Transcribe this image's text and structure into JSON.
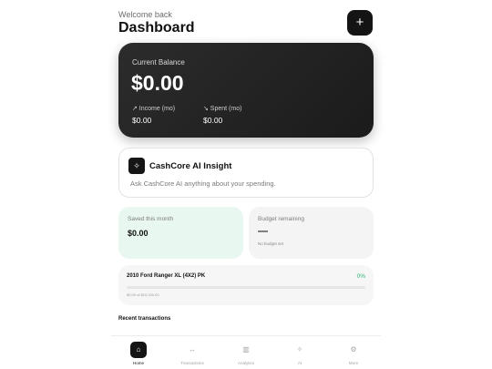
{
  "header": {
    "welcome": "Welcome back",
    "title": "Dashboard",
    "add_icon": "plus-icon",
    "add_label": "+"
  },
  "balance": {
    "label": "Current Balance",
    "amount": "$0.00",
    "income_label": "↗ Income (mo)",
    "income_value": "$0.00",
    "spent_label": "↘ Spent (mo)",
    "spent_value": "$0.00"
  },
  "ai_insight": {
    "icon": "sparkle-icon",
    "icon_glyph": "✧",
    "title": "CashCore AI Insight",
    "subtitle": "Ask CashCore AI anything about your spending."
  },
  "saved": {
    "label": "Saved this month",
    "value": "$0.00"
  },
  "budget": {
    "label": "Budget remaining",
    "value": "—",
    "note": "No budget set"
  },
  "goal": {
    "name": "2010 Ford Ranger XL (4X2) PK",
    "percent_label": "0%",
    "progress": 0,
    "subtext": "$0.00 of $10,000.00"
  },
  "recent": {
    "title": "Recent transactions"
  },
  "nav": {
    "active_color": "#141414",
    "items": [
      {
        "label": "Home",
        "icon": "home-icon",
        "glyph": "⌂"
      },
      {
        "label": "Transactions",
        "icon": "transactions-icon",
        "glyph": "↔"
      },
      {
        "label": "Analytics",
        "icon": "analytics-icon",
        "glyph": "▥"
      },
      {
        "label": "AI",
        "icon": "ai-sparkle-icon",
        "glyph": "✧"
      },
      {
        "label": "More",
        "icon": "gear-icon",
        "glyph": "⚙"
      }
    ]
  },
  "colors": {
    "accent_green": "#2bb673",
    "saved_bg": "#e8f7ef",
    "card_dark": "#1f1f1f"
  }
}
